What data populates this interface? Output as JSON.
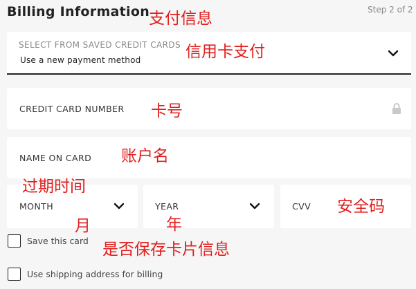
{
  "header": {
    "title": "Billing Information",
    "step": "Step 2 of 2"
  },
  "saved_cards": {
    "label": "SELECT FROM SAVED CREDIT CARDS",
    "value": "Use a new payment method",
    "icon": "chevron-down-icon"
  },
  "card_number": {
    "label": "CREDIT CARD NUMBER",
    "icon": "lock-icon"
  },
  "name_on_card": {
    "label": "NAME ON CARD"
  },
  "month": {
    "label": "MONTH",
    "icon": "chevron-down-icon"
  },
  "year": {
    "label": "YEAR",
    "icon": "chevron-down-icon"
  },
  "cvv": {
    "label": "CVV"
  },
  "checkboxes": {
    "save_card": "Save this card",
    "use_shipping": "Use shipping address for billing"
  },
  "annotations": {
    "payment_info": "支付信息",
    "credit_card_payment": "信用卡支付",
    "card_number": "卡号",
    "account_name": "账户名",
    "expiry": "过期时间",
    "month": "月",
    "year": "年",
    "security_code": "安全码",
    "save_card_question": "是否保存卡片信息"
  },
  "colors": {
    "annotation": "#e02020",
    "background": "#f6f6f6",
    "field": "#ffffff"
  }
}
